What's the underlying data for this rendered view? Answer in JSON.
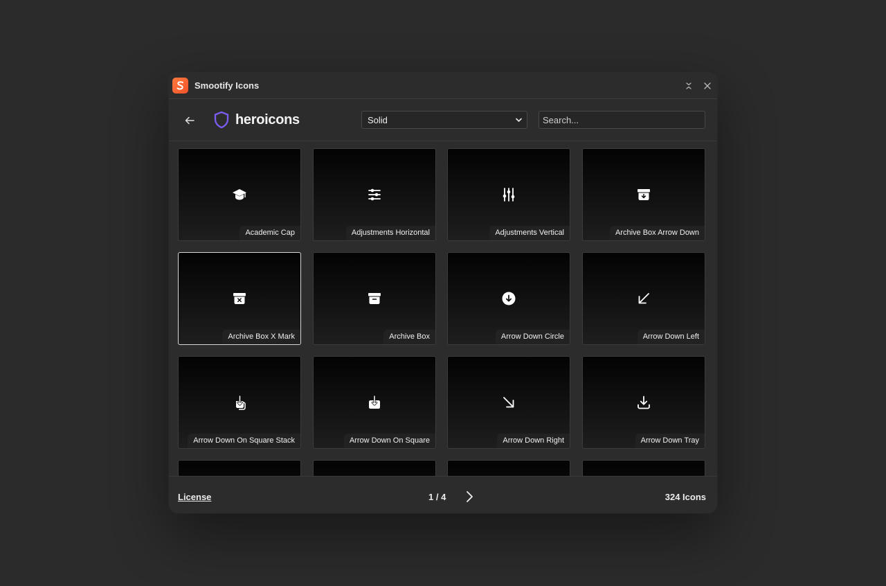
{
  "window": {
    "title": "Smootify Icons",
    "accent": "#f0522a"
  },
  "header": {
    "brand": "heroicons",
    "brand_color": "#7c5cf0",
    "style_select": {
      "selected": "Solid"
    },
    "search": {
      "placeholder": "Search...",
      "value": ""
    }
  },
  "icons": [
    {
      "label": "Academic Cap",
      "icon": "academic-cap-icon"
    },
    {
      "label": "Adjustments Horizontal",
      "icon": "adjustments-horizontal-icon"
    },
    {
      "label": "Adjustments Vertical",
      "icon": "adjustments-vertical-icon"
    },
    {
      "label": "Archive Box Arrow Down",
      "icon": "archive-box-arrow-down-icon"
    },
    {
      "label": "Archive Box X Mark",
      "icon": "archive-box-x-mark-icon",
      "selected": true
    },
    {
      "label": "Archive Box",
      "icon": "archive-box-icon"
    },
    {
      "label": "Arrow Down Circle",
      "icon": "arrow-down-circle-icon"
    },
    {
      "label": "Arrow Down Left",
      "icon": "arrow-down-left-icon"
    },
    {
      "label": "Arrow Down On Square Stack",
      "icon": "arrow-down-on-square-stack-icon"
    },
    {
      "label": "Arrow Down On Square",
      "icon": "arrow-down-on-square-icon"
    },
    {
      "label": "Arrow Down Right",
      "icon": "arrow-down-right-icon"
    },
    {
      "label": "Arrow Down Tray",
      "icon": "arrow-down-tray-icon"
    }
  ],
  "footer": {
    "license": "License",
    "page": "1 / 4",
    "count": "324 Icons"
  }
}
